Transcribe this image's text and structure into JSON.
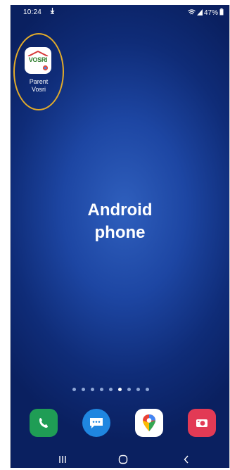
{
  "status_bar": {
    "time": "10:24",
    "sync_icon": "download-arrow-icon",
    "battery": "47%"
  },
  "home_app": {
    "label_line1": "Parent",
    "label_line2": "Vosri",
    "logo_text": "VOSRI",
    "highlight_color": "#e2ab2a"
  },
  "center": {
    "line1": "Android",
    "line2": "phone"
  },
  "page_indicator": {
    "count": 9,
    "active_index": 5
  },
  "dock": {
    "apps": [
      {
        "name": "phone-icon",
        "color": "#1f9d55"
      },
      {
        "name": "messages-icon",
        "color": "#1f86e0"
      },
      {
        "name": "maps-icon",
        "color": "#ffffff"
      },
      {
        "name": "camera-icon",
        "color": "#e23a55"
      }
    ]
  },
  "nav": {
    "recents": "recents-icon",
    "home": "home-icon",
    "back": "back-icon"
  }
}
